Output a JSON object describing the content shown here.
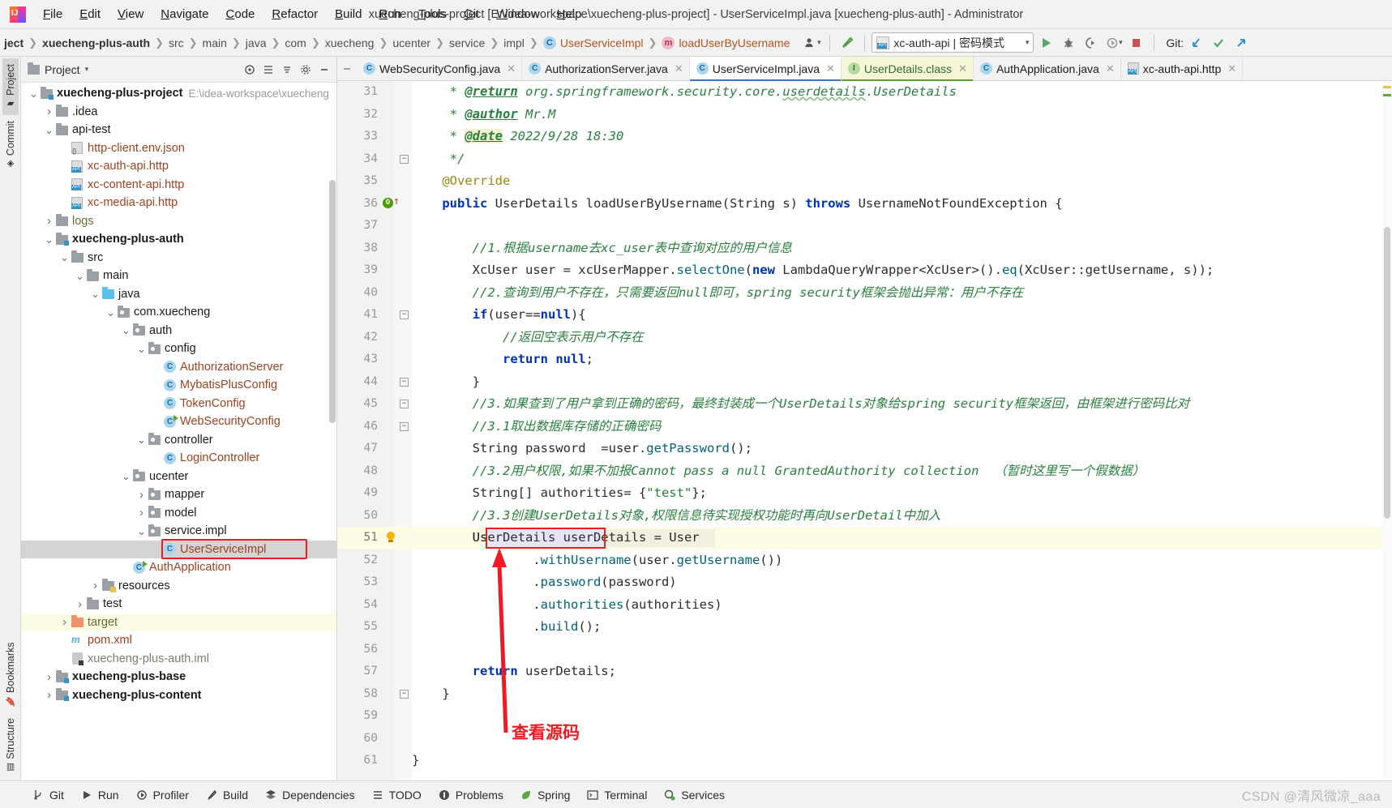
{
  "window": {
    "title": "xuecheng-plus-project [E:\\idea-workspace\\xuecheng-plus-project] - UserServiceImpl.java [xuecheng-plus-auth] - Administrator",
    "app_icon": "intellij-idea-logo"
  },
  "menubar": {
    "items": [
      {
        "label": "File",
        "mnemonic": "F"
      },
      {
        "label": "Edit",
        "mnemonic": "E"
      },
      {
        "label": "View",
        "mnemonic": "V"
      },
      {
        "label": "Navigate",
        "mnemonic": "N"
      },
      {
        "label": "Code",
        "mnemonic": "C"
      },
      {
        "label": "Refactor",
        "mnemonic": "R"
      },
      {
        "label": "Build",
        "mnemonic": "B"
      },
      {
        "label": "Run",
        "mnemonic": "R"
      },
      {
        "label": "Tools",
        "mnemonic": "T"
      },
      {
        "label": "Git",
        "mnemonic": "G"
      },
      {
        "label": "Window",
        "mnemonic": "W"
      },
      {
        "label": "Help",
        "mnemonic": "H"
      }
    ]
  },
  "navbar": {
    "breadcrumbs": [
      {
        "label": "ject",
        "icon": null,
        "style": "bold"
      },
      {
        "label": "xuecheng-plus-auth",
        "icon": null,
        "style": "bold"
      },
      {
        "label": "src",
        "icon": null,
        "style": "normal"
      },
      {
        "label": "main",
        "icon": null,
        "style": "normal"
      },
      {
        "label": "java",
        "icon": null,
        "style": "normal"
      },
      {
        "label": "com",
        "icon": null,
        "style": "normal"
      },
      {
        "label": "xuecheng",
        "icon": null,
        "style": "normal"
      },
      {
        "label": "ucenter",
        "icon": null,
        "style": "normal"
      },
      {
        "label": "service",
        "icon": null,
        "style": "normal"
      },
      {
        "label": "impl",
        "icon": null,
        "style": "normal"
      },
      {
        "label": "UserServiceImpl",
        "icon": "class-icon",
        "style": "file"
      },
      {
        "label": "loadUserByUsername",
        "icon": "method-icon",
        "style": "file"
      }
    ],
    "run_config": "xc-auth-api | 密码模式",
    "git_label": "Git:",
    "icons": [
      "user-profile-icon",
      "hammer-build-icon",
      "run-icon",
      "debug-icon",
      "run-with-coverage-icon",
      "profiler-icon",
      "stop-icon",
      "git-update-icon",
      "git-commit-icon",
      "git-push-icon"
    ]
  },
  "left_tool_strip": {
    "top": [
      {
        "label": "Project",
        "icon": "project-folder-icon",
        "active": true
      },
      {
        "label": "Commit",
        "icon": "commit-icon",
        "active": false
      }
    ],
    "bottom": [
      {
        "label": "Bookmarks",
        "icon": "bookmark-icon",
        "active": false
      },
      {
        "label": "Structure",
        "icon": "structure-icon",
        "active": false
      }
    ]
  },
  "project_panel": {
    "title": "Project",
    "header_icons": [
      "target-icon",
      "expand-all-icon",
      "collapse-all-icon",
      "settings-gear-icon",
      "hide-icon"
    ],
    "tree": [
      {
        "depth": 0,
        "label": "xuecheng-plus-project",
        "path": "E:\\idea-workspace\\xuecheng",
        "icon": "module-folder-icon",
        "arrow": "down",
        "bold": true,
        "color": "black"
      },
      {
        "depth": 1,
        "label": ".idea",
        "icon": "folder-icon",
        "arrow": "right",
        "bold": false,
        "color": "black"
      },
      {
        "depth": 1,
        "label": "api-test",
        "icon": "folder-icon",
        "arrow": "down",
        "bold": false,
        "color": "black"
      },
      {
        "depth": 2,
        "label": "http-client.env.json",
        "icon": "json-file-icon",
        "arrow": "none",
        "bold": false,
        "color": "brown"
      },
      {
        "depth": 2,
        "label": "xc-auth-api.http",
        "icon": "http-file-icon",
        "arrow": "none",
        "bold": false,
        "color": "brown"
      },
      {
        "depth": 2,
        "label": "xc-content-api.http",
        "icon": "http-file-icon",
        "arrow": "none",
        "bold": false,
        "color": "brown"
      },
      {
        "depth": 2,
        "label": "xc-media-api.http",
        "icon": "http-file-icon",
        "arrow": "none",
        "bold": false,
        "color": "brown"
      },
      {
        "depth": 1,
        "label": "logs",
        "icon": "folder-icon",
        "arrow": "right",
        "bold": false,
        "color": "olive"
      },
      {
        "depth": 1,
        "label": "xuecheng-plus-auth",
        "icon": "module-folder-icon",
        "arrow": "down",
        "bold": true,
        "color": "black"
      },
      {
        "depth": 2,
        "label": "src",
        "icon": "folder-icon",
        "arrow": "down",
        "bold": false,
        "color": "black"
      },
      {
        "depth": 3,
        "label": "main",
        "icon": "folder-icon",
        "arrow": "down",
        "bold": false,
        "color": "black"
      },
      {
        "depth": 4,
        "label": "java",
        "icon": "source-folder-icon",
        "arrow": "down",
        "bold": false,
        "color": "black"
      },
      {
        "depth": 5,
        "label": "com.xuecheng",
        "icon": "package-icon",
        "arrow": "down",
        "bold": false,
        "color": "black"
      },
      {
        "depth": 6,
        "label": "auth",
        "icon": "package-icon",
        "arrow": "down",
        "bold": false,
        "color": "black"
      },
      {
        "depth": 7,
        "label": "config",
        "icon": "package-icon",
        "arrow": "down",
        "bold": false,
        "color": "black"
      },
      {
        "depth": 8,
        "label": "AuthorizationServer",
        "icon": "class-icon",
        "arrow": "none",
        "bold": false,
        "color": "brown"
      },
      {
        "depth": 8,
        "label": "MybatisPlusConfig",
        "icon": "class-icon",
        "arrow": "none",
        "bold": false,
        "color": "brown"
      },
      {
        "depth": 8,
        "label": "TokenConfig",
        "icon": "class-icon",
        "arrow": "none",
        "bold": false,
        "color": "brown"
      },
      {
        "depth": 8,
        "label": "WebSecurityConfig",
        "icon": "class-runnable-icon",
        "arrow": "none",
        "bold": false,
        "color": "brown"
      },
      {
        "depth": 7,
        "label": "controller",
        "icon": "package-icon",
        "arrow": "down",
        "bold": false,
        "color": "black"
      },
      {
        "depth": 8,
        "label": "LoginController",
        "icon": "class-icon",
        "arrow": "none",
        "bold": false,
        "color": "brown"
      },
      {
        "depth": 6,
        "label": "ucenter",
        "icon": "package-icon",
        "arrow": "down",
        "bold": false,
        "color": "black"
      },
      {
        "depth": 7,
        "label": "mapper",
        "icon": "package-icon",
        "arrow": "right",
        "bold": false,
        "color": "black"
      },
      {
        "depth": 7,
        "label": "model",
        "icon": "package-icon",
        "arrow": "right",
        "bold": false,
        "color": "black"
      },
      {
        "depth": 7,
        "label": "service.impl",
        "icon": "package-icon",
        "arrow": "down",
        "bold": false,
        "color": "black"
      },
      {
        "depth": 8,
        "label": "UserServiceImpl",
        "icon": "class-icon",
        "arrow": "none",
        "bold": false,
        "color": "brown",
        "selected": true,
        "highlighted": true
      },
      {
        "depth": 6,
        "label": "AuthApplication",
        "icon": "class-runnable-icon",
        "arrow": "none",
        "bold": false,
        "color": "brown"
      },
      {
        "depth": 4,
        "label": "resources",
        "icon": "resources-folder-icon",
        "arrow": "right",
        "bold": false,
        "color": "black"
      },
      {
        "depth": 3,
        "label": "test",
        "icon": "folder-icon",
        "arrow": "right",
        "bold": false,
        "color": "black"
      },
      {
        "depth": 2,
        "label": "target",
        "icon": "target-folder-icon",
        "arrow": "right",
        "bold": false,
        "color": "olive",
        "rowhl": true
      },
      {
        "depth": 2,
        "label": "pom.xml",
        "icon": "maven-icon",
        "arrow": "none",
        "bold": false,
        "color": "brown"
      },
      {
        "depth": 2,
        "label": "xuecheng-plus-auth.iml",
        "icon": "iml-file-icon",
        "arrow": "none",
        "bold": false,
        "color": "grey"
      },
      {
        "depth": 1,
        "label": "xuecheng-plus-base",
        "icon": "module-folder-icon",
        "arrow": "right",
        "bold": true,
        "color": "black"
      },
      {
        "depth": 1,
        "label": "xuecheng-plus-content",
        "icon": "module-folder-icon",
        "arrow": "right",
        "bold": true,
        "color": "black"
      }
    ]
  },
  "editor_tabs": [
    {
      "label": "WebSecurityConfig.java",
      "icon": "class-icon",
      "active": false,
      "highlight": false
    },
    {
      "label": "AuthorizationServer.java",
      "icon": "class-icon",
      "active": false,
      "highlight": false
    },
    {
      "label": "UserServiceImpl.java",
      "icon": "class-icon",
      "active": true,
      "highlight": false
    },
    {
      "label": "UserDetails.class",
      "icon": "interface-icon",
      "active": false,
      "highlight": true
    },
    {
      "label": "AuthApplication.java",
      "icon": "class-runnable-icon",
      "active": false,
      "highlight": false
    },
    {
      "label": "xc-auth-api.http",
      "icon": "http-file-icon",
      "active": false,
      "highlight": false
    }
  ],
  "code": {
    "first_line_number": 31,
    "current_line": 51,
    "lines": [
      {
        "n": 31,
        "html": "     * <u class='jdtag'>@return</u> org.springframework.security.core.<span class='wavy'>userdetails</span>.UserDetails",
        "cls": "jd"
      },
      {
        "n": 32,
        "html": "     * <u class='jdtag'>@author</u> Mr.M",
        "cls": "jd"
      },
      {
        "n": 33,
        "html": "     * <span class='jdtag jdhl'>@date</span> 2022/9/28 18:30",
        "cls": "jd"
      },
      {
        "n": 34,
        "html": "     */",
        "cls": "jd"
      },
      {
        "n": 35,
        "html": "    @Override",
        "cls": "anno"
      },
      {
        "n": 36,
        "html": "    public UserDetails loadUserByUsername(String s) throws UsernameNotFoundException {",
        "cls": ""
      },
      {
        "n": 37,
        "html": "",
        "cls": ""
      },
      {
        "n": 38,
        "html": "        //1.根据username去xc_user表中查询对应的用户信息",
        "cls": "cmg"
      },
      {
        "n": 39,
        "html": "        XcUser user = xcUserMapper.selectOne(new LambdaQueryWrapper<XcUser>().eq(XcUser::getUsername, s));",
        "cls": ""
      },
      {
        "n": 40,
        "html": "        //2.查询到用户不存在，只需要返回null即可，spring security框架会抛出异常：用户不存在",
        "cls": "cmg"
      },
      {
        "n": 41,
        "html": "        if(user==null){",
        "cls": ""
      },
      {
        "n": 42,
        "html": "            //返回空表示用户不存在",
        "cls": "cmg"
      },
      {
        "n": 43,
        "html": "            return null;",
        "cls": ""
      },
      {
        "n": 44,
        "html": "        }",
        "cls": ""
      },
      {
        "n": 45,
        "html": "        //3.如果查到了用户拿到正确的密码，最终封装成一个UserDetails对象给spring security框架返回，由框架进行密码比对",
        "cls": "cmg"
      },
      {
        "n": 46,
        "html": "        //3.1取出数据库存储的正确密码",
        "cls": "cmg"
      },
      {
        "n": 47,
        "html": "        String password  =user.getPassword();",
        "cls": ""
      },
      {
        "n": 48,
        "html": "        //3.2用户权限,如果不加报Cannot pass a null GrantedAuthority collection  （暂时这里写一个假数据）",
        "cls": "cmg"
      },
      {
        "n": 49,
        "html": "        String[] authorities= {\"test\"};",
        "cls": ""
      },
      {
        "n": 50,
        "html": "        //3.3创建UserDetails对象,权限信息待实现授权功能时再向UserDetail中加入",
        "cls": "cmg"
      },
      {
        "n": 51,
        "html": "        UserDetails userDetails = User",
        "cls": ""
      },
      {
        "n": 52,
        "html": "                .withUsername(user.getUsername())",
        "cls": ""
      },
      {
        "n": 53,
        "html": "                .password(password)",
        "cls": ""
      },
      {
        "n": 54,
        "html": "                .authorities(authorities)",
        "cls": ""
      },
      {
        "n": 55,
        "html": "                .build();",
        "cls": ""
      },
      {
        "n": 56,
        "html": "",
        "cls": ""
      },
      {
        "n": 57,
        "html": "        return userDetails;",
        "cls": ""
      },
      {
        "n": 58,
        "html": "    }",
        "cls": ""
      },
      {
        "n": 59,
        "html": "",
        "cls": ""
      },
      {
        "n": 60,
        "html": "",
        "cls": ""
      },
      {
        "n": 61,
        "html": "}",
        "cls": ""
      }
    ]
  },
  "annotations": {
    "label": "查看源码",
    "color": "#ed1c24"
  },
  "statusbar": {
    "items": [
      {
        "label": "Git",
        "icon": "git-branch-icon"
      },
      {
        "label": "Run",
        "icon": "run-play-icon"
      },
      {
        "label": "Profiler",
        "icon": "profiler-icon"
      },
      {
        "label": "Build",
        "icon": "build-hammer-icon"
      },
      {
        "label": "Dependencies",
        "icon": "dependencies-icon"
      },
      {
        "label": "TODO",
        "icon": "todo-list-icon"
      },
      {
        "label": "Problems",
        "icon": "problems-icon"
      },
      {
        "label": "Spring",
        "icon": "spring-leaf-icon"
      },
      {
        "label": "Terminal",
        "icon": "terminal-icon"
      },
      {
        "label": "Services",
        "icon": "services-icon"
      }
    ],
    "watermark": "CSDN @清风微凉_aaa"
  }
}
